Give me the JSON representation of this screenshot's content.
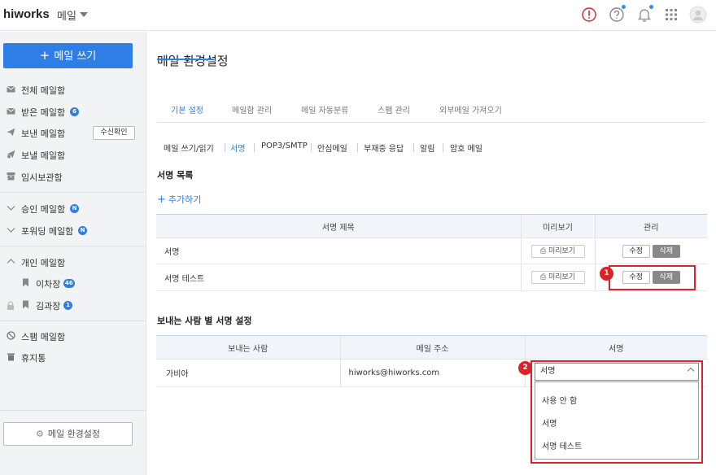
{
  "topbar": {
    "logo": "hiworks",
    "app_name": "메일"
  },
  "sidebar": {
    "compose_label": "메일 쓰기",
    "items": [
      {
        "label": "전체 메일함"
      },
      {
        "label": "받은 메일함",
        "badge": "6"
      },
      {
        "label": "보낸 메일함",
        "action_label": "수신확인"
      },
      {
        "label": "보낼 메일함"
      },
      {
        "label": "임시보관함"
      },
      {
        "label": "승인 메일함",
        "badge": "N"
      },
      {
        "label": "포워딩 메일함",
        "badge": "N"
      },
      {
        "label": "개인 메일함"
      },
      {
        "label": "이차장",
        "badge": "46"
      },
      {
        "label": "김과장",
        "badge": "1"
      },
      {
        "label": "스팸 메일함"
      },
      {
        "label": "휴지통"
      }
    ],
    "settings_label": "메일 환경설정"
  },
  "main": {
    "title": "메일 환경설정",
    "tabs": [
      {
        "label": "기본 설정"
      },
      {
        "label": "메일함 관리"
      },
      {
        "label": "메일 자동분류"
      },
      {
        "label": "스팸 관리"
      },
      {
        "label": "외부메일 가져오기"
      }
    ],
    "subtabs": [
      {
        "label": "메일 쓰기/읽기"
      },
      {
        "label": "서명"
      },
      {
        "label": "POP3/SMTP"
      },
      {
        "label": "안심메일"
      },
      {
        "label": "부재중 응답"
      },
      {
        "label": "알림"
      },
      {
        "label": "암호 메일"
      }
    ],
    "signature_list_title": "서명 목록",
    "add_label": "추가하기",
    "sig_table": {
      "headers": [
        "서명 제목",
        "미리보기",
        "관리"
      ],
      "rows": [
        {
          "title": "서명",
          "preview": "미리보기",
          "edit": "수정",
          "delete": "삭제"
        },
        {
          "title": "서명 테스트",
          "preview": "미리보기",
          "edit": "수정",
          "delete": "삭제"
        }
      ]
    },
    "sender_section_title": "보내는 사람 별 서명 설정",
    "sender_table": {
      "headers": [
        "보내는 사람",
        "메일 주소",
        "서명"
      ],
      "rows": [
        {
          "sender": "가비아",
          "email": "hiworks@hiworks.com",
          "signature": "서명"
        }
      ]
    },
    "dropdown_options": [
      "사용 안 함",
      "서명",
      "서명 테스트"
    ],
    "annotations": [
      "1",
      "2"
    ]
  },
  "colors": {
    "accent": "#2f7ee6",
    "highlight": "#d9232b",
    "badge": "#2f7ee6"
  }
}
